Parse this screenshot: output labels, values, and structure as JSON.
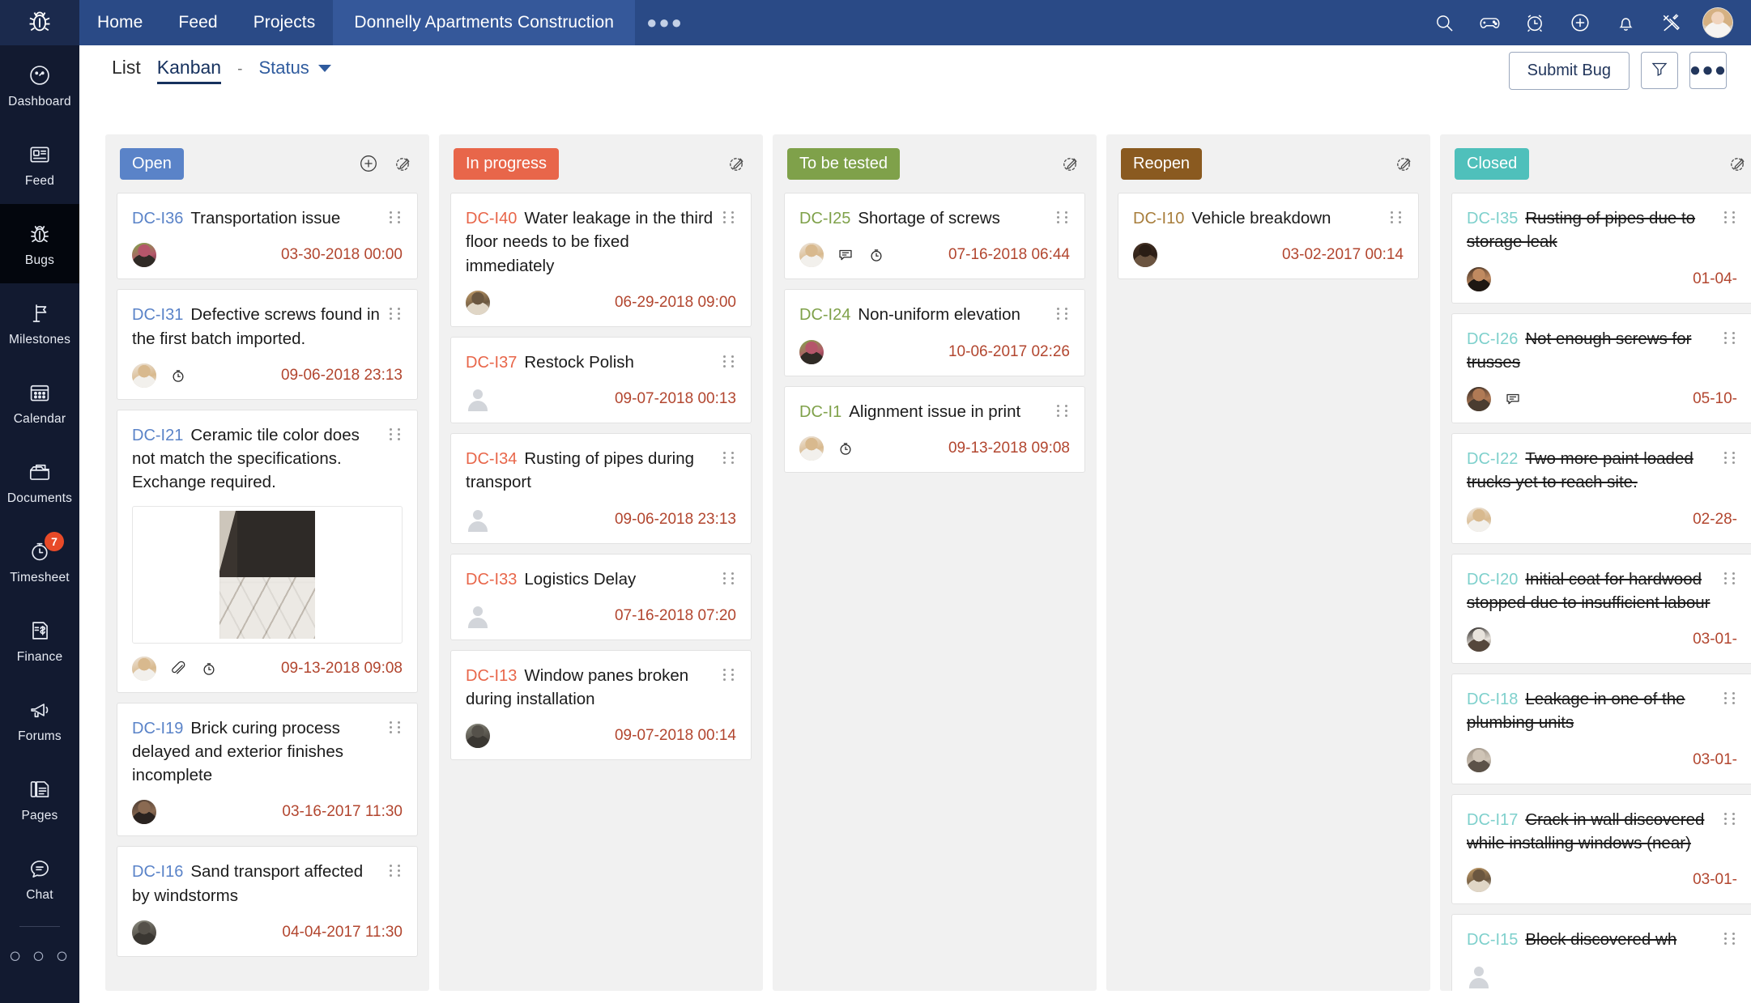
{
  "topbar": {
    "logo_icon": "bug-icon",
    "nav": [
      {
        "label": "Home"
      },
      {
        "label": "Feed"
      },
      {
        "label": "Projects"
      }
    ],
    "project_tab": "Donnelly Apartments Construction",
    "overflow": "●●●",
    "icons": [
      "search-icon",
      "game-controller-icon",
      "alarm-clock-icon",
      "add-circle-icon",
      "bell-icon",
      "tools-icon"
    ],
    "avatar": "user-avatar",
    "bg_color": "#2a4a86"
  },
  "sidebar": {
    "items": [
      {
        "label": "Dashboard",
        "icon": "speedometer-icon",
        "active": false,
        "badge": ""
      },
      {
        "label": "Feed",
        "icon": "news-icon",
        "active": false,
        "badge": ""
      },
      {
        "label": "Bugs",
        "icon": "bug-icon",
        "active": true,
        "badge": ""
      },
      {
        "label": "Milestones",
        "icon": "flag-icon",
        "active": false,
        "badge": ""
      },
      {
        "label": "Calendar",
        "icon": "calendar-icon",
        "active": false,
        "badge": ""
      },
      {
        "label": "Documents",
        "icon": "folder-icon",
        "active": false,
        "badge": ""
      },
      {
        "label": "Timesheet",
        "icon": "stopwatch-icon",
        "active": false,
        "badge": "7"
      },
      {
        "label": "Finance",
        "icon": "invoice-dollar-icon",
        "active": false,
        "badge": ""
      },
      {
        "label": "Forums",
        "icon": "megaphone-icon",
        "active": false,
        "badge": ""
      },
      {
        "label": "Pages",
        "icon": "pages-icon",
        "active": false,
        "badge": ""
      },
      {
        "label": "Chat",
        "icon": "chat-bubble-icon",
        "active": false,
        "badge": ""
      }
    ],
    "more": "○ ○ ○",
    "badge_color": "#e84a28",
    "bg_color": "#121a30"
  },
  "toolbar": {
    "views": [
      {
        "label": "List",
        "active": false
      },
      {
        "label": "Kanban",
        "active": true
      }
    ],
    "separator": "-",
    "group_by": "Status",
    "submit_label": "Submit Bug",
    "filter_icon": "funnel-icon",
    "more_icon": "ellipsis-icon",
    "more_label": "●●●"
  },
  "board": {
    "columns": [
      {
        "name": "Open",
        "color": "#5a83c8",
        "key_color": "#5a83c8",
        "has_add": true,
        "add_icon": "plus-circle-icon",
        "edit_icon": "edit-pencil-icon",
        "cards": [
          {
            "key": "DC-I36",
            "title": "Transportation issue",
            "date": "03-30-2018 00:00",
            "done": false,
            "avatar": "assignee-avatar",
            "avatar_colors": [
              "#7fa84a",
              "#b5566a",
              "#2f2a25"
            ],
            "icons": [],
            "image": false
          },
          {
            "key": "DC-I31",
            "title": "Defective screws found in the first batch imported.",
            "date": "09-06-2018 23:13",
            "done": false,
            "avatar": "assignee-avatar",
            "avatar_colors": [
              "#efe7de",
              "#d8b98e",
              "#f2f0ec"
            ],
            "icons": [
              "stopwatch-icon"
            ],
            "image": false
          },
          {
            "key": "DC-I21",
            "title": "Ceramic tile color does not match the specifications. Exchange required.",
            "date": "09-13-2018 09:08",
            "done": false,
            "avatar": "assignee-avatar",
            "avatar_colors": [
              "#efe7de",
              "#d8b98e",
              "#f2f0ec"
            ],
            "icons": [
              "attachment-icon",
              "stopwatch-icon"
            ],
            "image": true,
            "image_name": "ceramic-tile-photo"
          },
          {
            "key": "DC-I19",
            "title": "Brick curing process delayed and exterior finishes incomplete",
            "date": "03-16-2017 11:30",
            "done": false,
            "avatar": "assignee-avatar",
            "avatar_colors": [
              "#4a3a30",
              "#8a6a52",
              "#2a2320"
            ],
            "icons": [],
            "image": false
          },
          {
            "key": "DC-I16",
            "title": "Sand transport affected by windstorms",
            "date": "04-04-2017 11:30",
            "done": false,
            "avatar": "assignee-avatar",
            "avatar_colors": [
              "#8c8c80",
              "#55514a",
              "#3a3732"
            ],
            "icons": [],
            "image": false
          }
        ]
      },
      {
        "name": "In progress",
        "color": "#e8664a",
        "key_color": "#e8664a",
        "has_add": false,
        "edit_icon": "edit-pencil-icon",
        "cards": [
          {
            "key": "DC-I40",
            "title": "Water leakage in the third floor needs to be fixed immediately",
            "date": "06-29-2018 09:00",
            "done": false,
            "avatar": "assignee-avatar",
            "avatar_colors": [
              "#c7a06a",
              "#6b5740",
              "#e0d6c6"
            ],
            "icons": [],
            "image": false
          },
          {
            "key": "DC-I37",
            "title": "Restock Polish",
            "date": "09-07-2018 00:13",
            "done": false,
            "avatar": "",
            "avatar_colors": [],
            "icons": [],
            "image": false
          },
          {
            "key": "DC-I34",
            "title": "Rusting of pipes during transport",
            "date": "09-06-2018 23:13",
            "done": false,
            "avatar": "",
            "avatar_colors": [],
            "icons": [],
            "image": false
          },
          {
            "key": "DC-I33",
            "title": "Logistics Delay",
            "date": "07-16-2018 07:20",
            "done": false,
            "avatar": "",
            "avatar_colors": [],
            "icons": [],
            "image": false
          },
          {
            "key": "DC-I13",
            "title": "Window panes broken during installation",
            "date": "09-07-2018 00:14",
            "done": false,
            "avatar": "assignee-avatar",
            "avatar_colors": [
              "#8c8c80",
              "#55514a",
              "#3a3732"
            ],
            "icons": [],
            "image": false
          }
        ]
      },
      {
        "name": "To be tested",
        "color": "#7fa14a",
        "key_color": "#7fa14a",
        "has_add": false,
        "edit_icon": "edit-pencil-icon",
        "cards": [
          {
            "key": "DC-I25",
            "title": "Shortage of screws",
            "date": "07-16-2018 06:44",
            "done": false,
            "avatar": "assignee-avatar",
            "avatar_colors": [
              "#efe7de",
              "#d8b98e",
              "#f2f0ec"
            ],
            "icons": [
              "comment-icon",
              "stopwatch-icon"
            ],
            "image": false
          },
          {
            "key": "DC-I24",
            "title": "Non-uniform elevation",
            "date": "10-06-2017 02:26",
            "done": false,
            "avatar": "assignee-avatar",
            "avatar_colors": [
              "#7fa84a",
              "#b5566a",
              "#2f2a25"
            ],
            "icons": [],
            "image": false
          },
          {
            "key": "DC-I1",
            "title": "Alignment issue in print",
            "date": "09-13-2018 09:08",
            "done": false,
            "avatar": "assignee-avatar",
            "avatar_colors": [
              "#efe7de",
              "#d8b98e",
              "#f2f0ec"
            ],
            "icons": [
              "stopwatch-icon"
            ],
            "image": false
          }
        ]
      },
      {
        "name": "Reopen",
        "color": "#8a5a20",
        "key_color": "#a87e3c",
        "has_add": false,
        "edit_icon": "edit-pencil-icon",
        "cards": [
          {
            "key": "DC-I10",
            "title": "Vehicle breakdown",
            "date": "03-02-2017 00:14",
            "done": false,
            "avatar": "assignee-avatar",
            "avatar_colors": [
              "#4a3528",
              "#2a1d15",
              "#6b5440"
            ],
            "icons": [],
            "image": false
          }
        ]
      },
      {
        "name": "Closed",
        "color": "#4fc0bb",
        "key_color": "#7ed0cc",
        "has_add": false,
        "edit_icon": "edit-pencil-icon",
        "cards": [
          {
            "key": "DC-I35",
            "title": "Rusting of pipes due to storage leak",
            "date": "01-04-",
            "done": true,
            "avatar": "assignee-avatar",
            "avatar_colors": [
              "#3a2a1e",
              "#c08a60",
              "#1e1712"
            ],
            "icons": [],
            "image": false
          },
          {
            "key": "DC-I26",
            "title": "Not enough screws for trusses",
            "date": "05-10-",
            "done": true,
            "avatar": "assignee-avatar",
            "avatar_colors": [
              "#2a2420",
              "#b07a55",
              "#4a3c30"
            ],
            "icons": [
              "comment-icon"
            ],
            "image": false
          },
          {
            "key": "DC-I22",
            "title": "Two more paint loaded trucks yet to reach site.",
            "date": "02-28-",
            "done": true,
            "avatar": "assignee-avatar",
            "avatar_colors": [
              "#efe7de",
              "#d8b98e",
              "#f2f0ec"
            ],
            "icons": [],
            "image": false
          },
          {
            "key": "DC-I20",
            "title": "Initial coat for hardwood stopped due to insufficient labour",
            "date": "03-01-",
            "done": true,
            "avatar": "assignee-avatar",
            "avatar_colors": [
              "#1e1a18",
              "#e8e3dc",
              "#55473c"
            ],
            "icons": [],
            "image": false
          },
          {
            "key": "DC-I18",
            "title": "Leakage in one of the plumbing units",
            "date": "03-01-",
            "done": true,
            "avatar": "assignee-avatar",
            "avatar_colors": [
              "#9a8f82",
              "#cfc4b6",
              "#5c5248"
            ],
            "icons": [],
            "image": false
          },
          {
            "key": "DC-I17",
            "title": "Crack in wall discovered while installing windows (near)",
            "date": "03-01-",
            "done": true,
            "avatar": "assignee-avatar",
            "avatar_colors": [
              "#c7a06a",
              "#6b5740",
              "#e0d6c6"
            ],
            "icons": [],
            "image": false
          },
          {
            "key": "DC-I15",
            "title": "Block discovered wh",
            "date": "",
            "done": true,
            "avatar": "",
            "avatar_colors": [],
            "icons": [],
            "image": false
          }
        ]
      }
    ]
  }
}
